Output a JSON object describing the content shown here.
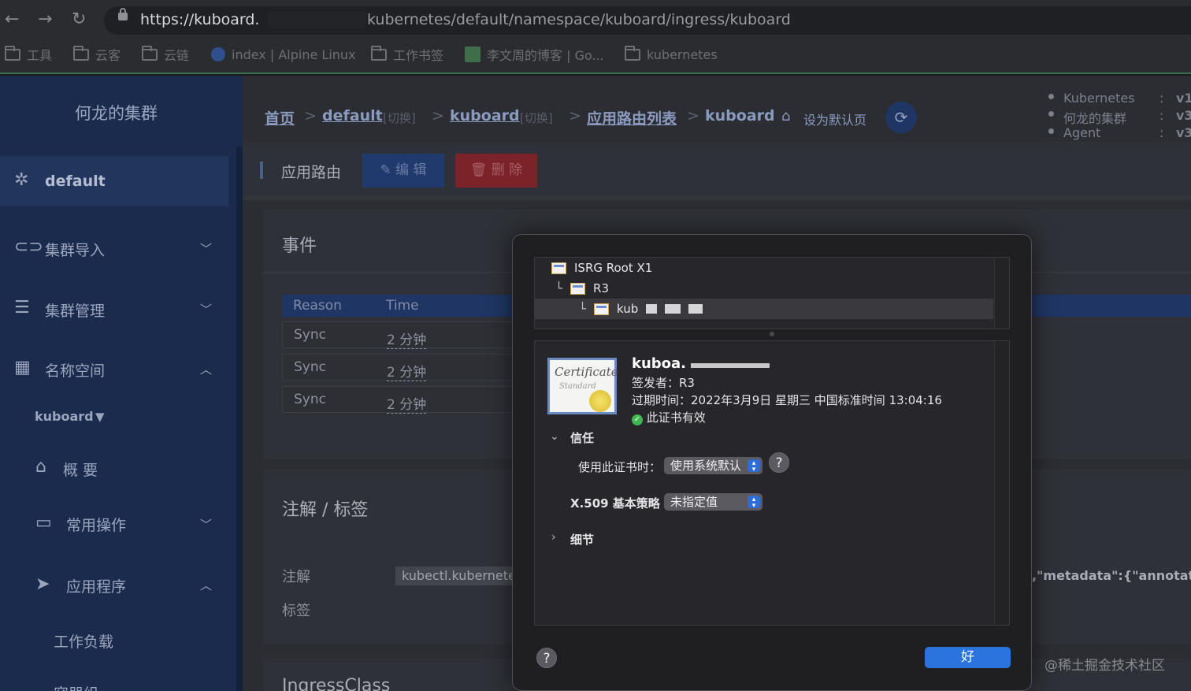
{
  "browser": {
    "url_host": "https://kuboard.",
    "url_path": "kubernetes/default/namespace/kuboard/ingress/kuboard",
    "bookmarks": [
      {
        "icon": "folder-icon",
        "label": "工具"
      },
      {
        "icon": "folder-icon",
        "label": "云客"
      },
      {
        "icon": "folder-icon",
        "label": "云链"
      },
      {
        "icon": "globe-icon",
        "label": "index | Alpine Linux"
      },
      {
        "icon": "folder-icon",
        "label": "工作书签"
      },
      {
        "icon": "blog-icon",
        "label": "李文周的博客 | Go..."
      },
      {
        "icon": "folder-icon",
        "label": "kubernetes"
      }
    ]
  },
  "sidebar": {
    "cluster_name": "何龙的集群",
    "active": "default",
    "items": [
      {
        "label": "集群导入"
      },
      {
        "label": "集群管理"
      },
      {
        "label": "名称空间"
      }
    ],
    "namespace": "kuboard",
    "sub_items": [
      {
        "label": "概 要"
      },
      {
        "label": "常用操作"
      },
      {
        "label": "应用程序"
      },
      {
        "label": "工作负载"
      },
      {
        "label": "容器组"
      }
    ]
  },
  "breadcrumb": {
    "home": "首页",
    "cluster": "default",
    "switch1": "[切换]",
    "namespace": "kuboard",
    "switch2": "[切换]",
    "list": "应用路由列表",
    "current": "kuboard",
    "set_default": "设为默认页"
  },
  "versions": [
    {
      "name": "Kubernetes",
      "sep": ":",
      "value": "v1"
    },
    {
      "name": "何龙的集群",
      "sep": ":",
      "value": "v3"
    },
    {
      "name": "Agent",
      "sep": ":",
      "value": "v3"
    }
  ],
  "page": {
    "title": "应用路由",
    "edit_label": "编 辑",
    "delete_label": "删 除"
  },
  "events": {
    "title": "事件",
    "headers": [
      "Reason",
      "Time"
    ],
    "rows": [
      {
        "reason": "Sync",
        "time": "2 分钟"
      },
      {
        "reason": "Sync",
        "time": "2 分钟"
      },
      {
        "reason": "Sync",
        "time": "2 分钟"
      }
    ]
  },
  "annotations": {
    "title": "注解 / 标签",
    "annotation_label": "注解",
    "label_label": "标签",
    "annotation_value": "kubectl.kubernetes",
    "annotation_tail": ",\"metadata\":{\"annotations"
  },
  "ingress_class_title": "IngressClass",
  "dialog": {
    "chain": [
      "ISRG Root X1",
      "R3",
      "kub"
    ],
    "cert_name": "kuboa.",
    "issuer": "签发者：R3",
    "expires": "过期时间：2022年3月9日 星期三 中国标准时间 13:04:16",
    "valid": "此证书有效",
    "trust_section": "信任",
    "when_using_label": "使用此证书时：",
    "when_using_value": "使用系统默认",
    "x509_label": "X.509 基本策略",
    "x509_value": "未指定值",
    "details_section": "细节",
    "help": "?",
    "ok": "好",
    "cert_badge_line1": "Certificate",
    "cert_badge_line2": "Standard"
  },
  "watermark": "@稀土掘金技术社区"
}
